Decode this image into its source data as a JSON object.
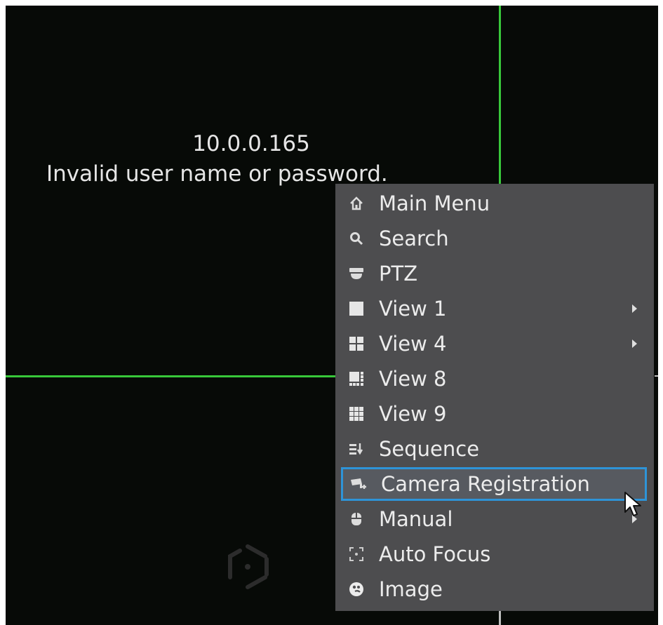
{
  "channel": {
    "ip_address": "10.0.0.165",
    "error_message": "Invalid user name or password."
  },
  "context_menu": {
    "items": [
      {
        "label": "Main Menu",
        "icon": "home-icon"
      },
      {
        "label": "Search",
        "icon": "search-icon"
      },
      {
        "label": "PTZ",
        "icon": "ptz-dome-icon"
      },
      {
        "label": "View 1",
        "icon": "view-1-icon",
        "has_submenu": true
      },
      {
        "label": "View 4",
        "icon": "view-4-icon",
        "has_submenu": true
      },
      {
        "label": "View 8",
        "icon": "view-8-icon"
      },
      {
        "label": "View 9",
        "icon": "view-9-icon"
      },
      {
        "label": "Sequence",
        "icon": "sequence-icon"
      },
      {
        "label": "Camera Registration",
        "icon": "camera-registration-icon",
        "selected": true
      },
      {
        "label": "Manual",
        "icon": "manual-record-icon",
        "has_submenu": true
      },
      {
        "label": "Auto Focus",
        "icon": "auto-focus-icon"
      },
      {
        "label": "Image",
        "icon": "image-palette-icon"
      }
    ]
  },
  "colors": {
    "screen_background": "#070a07",
    "split_line": "#38c83a",
    "menu_background": "#4d4d4f",
    "selection_border": "#2e94d8",
    "text": "#ececec"
  }
}
